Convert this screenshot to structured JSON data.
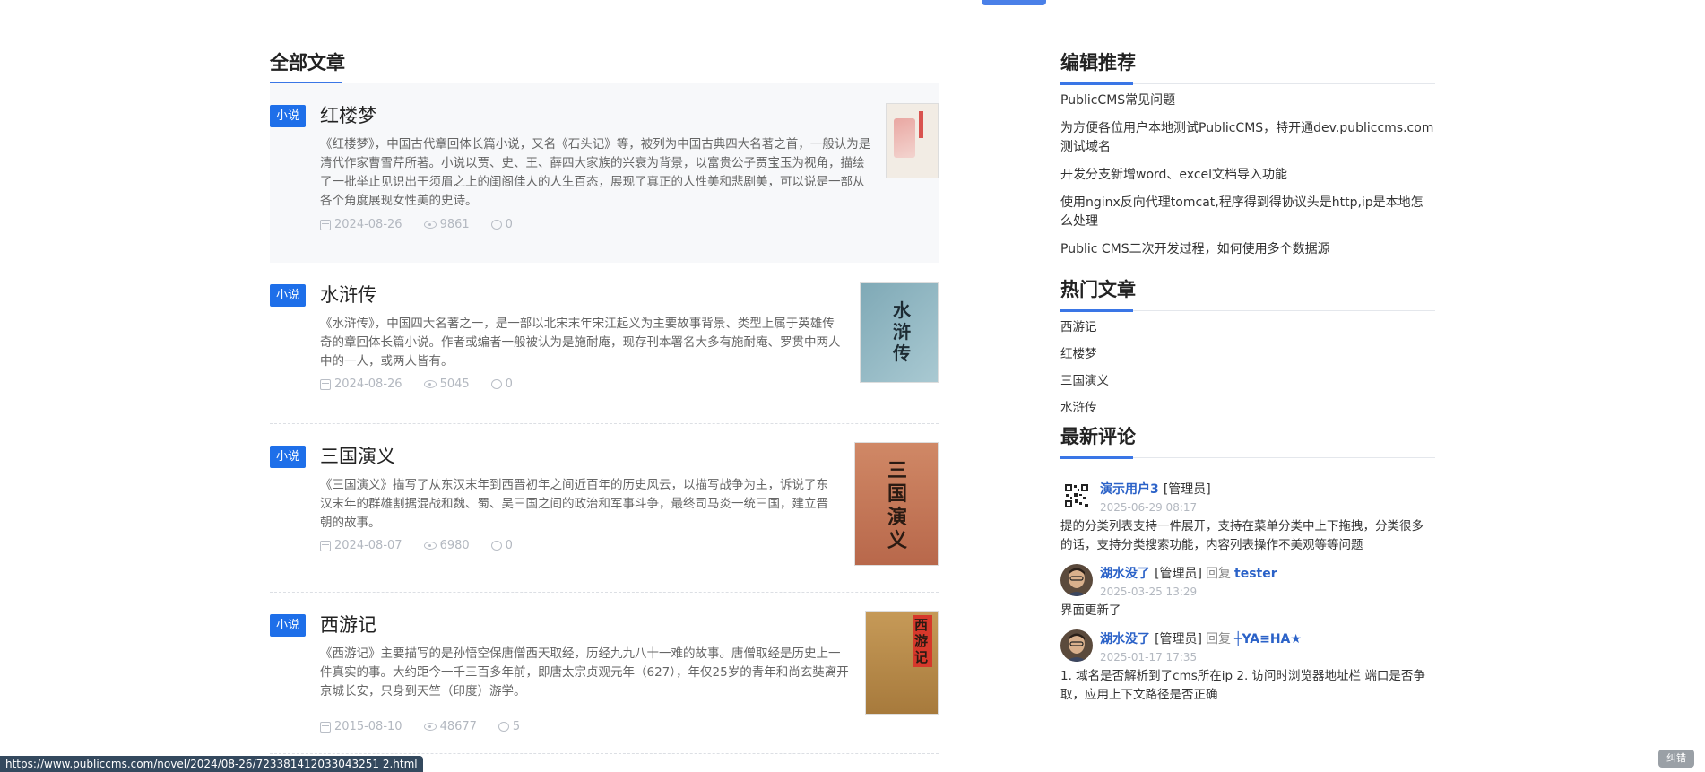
{
  "main": {
    "section_title": "全部文章",
    "articles": [
      {
        "category": "小说",
        "title": "红楼梦",
        "description": "《红楼梦》，中国古代章回体长篇小说，又名《石头记》等，被列为中国古典四大名著之首，一般认为是清代作家曹雪芹所著。小说以贾、史、王、薛四大家族的兴衰为背景，以富贵公子贾宝玉为视角，描绘了一批举止见识出于须眉之上的闺阁佳人的人生百态，展现了真正的人性美和悲剧美，可以说是一部从各个角度展现女性美的史诗。",
        "date": "2024-08-26",
        "views": "9861",
        "comments": "0",
        "cover_color": "#f2ece4"
      },
      {
        "category": "小说",
        "title": "水浒传",
        "description": "《水浒传》，中国四大名著之一，是一部以北宋末年宋江起义为主要故事背景、类型上属于英雄传奇的章回体长篇小说。作者或编者一般被认为是施耐庵，现存刊本署名大多有施耐庵、罗贯中两人中的一人，或两人皆有。",
        "date": "2024-08-26",
        "views": "5045",
        "comments": "0",
        "cover_color": "#8fb7c3"
      },
      {
        "category": "小说",
        "title": "三国演义",
        "description": "《三国演义》描写了从东汉末年到西晋初年之间近百年的历史风云，以描写战争为主，诉说了东汉末年的群雄割据混战和魏、蜀、吴三国之间的政治和军事斗争，最终司马炎一统三国，建立晋朝的故事。",
        "date": "2024-08-07",
        "views": "6980",
        "comments": "0",
        "cover_color": "#c9775a"
      },
      {
        "category": "小说",
        "title": "西游记",
        "description": "《西游记》主要描写的是孙悟空保唐僧西天取经，历经九九八十一难的故事。唐僧取经是历史上一件真实的事。大约距今一千三百多年前，即唐太宗贞观元年（627），年仅25岁的青年和尚玄奘离开京城长安，只身到天竺（印度）游学。",
        "date": "2015-08-10",
        "views": "48677",
        "comments": "5",
        "cover_color": "#b88a4a"
      }
    ]
  },
  "sidebar": {
    "editor_title": "编辑推荐",
    "editor_items": [
      "PublicCMS常见问题",
      "为方便各位用户本地测试PublicCMS，特开通dev.publiccms.com测试域名",
      "开发分支新增word、excel文档导入功能",
      "使用nginx反向代理tomcat,程序得到得协议头是http,ip是本地怎么处理",
      "Public CMS二次开发过程，如何使用多个数据源"
    ],
    "hot_title": "热门文章",
    "hot_items": [
      "西游记",
      "红楼梦",
      "三国演义",
      "水浒传"
    ],
    "comments_title": "最新评论",
    "comments": [
      {
        "name": "演示用户3",
        "role": "[管理员]",
        "reply_label": "",
        "reply_to": "",
        "time": "2025-06-29 08:17",
        "body": "提的分类列表支持一件展开，支持在菜单分类中上下拖拽，分类很多的话，支持分类搜索功能，内容列表操作不美观等等问题"
      },
      {
        "name": "湖水没了",
        "role": "[管理员]",
        "reply_label": "回复",
        "reply_to": "tester",
        "time": "2025-03-25 13:29",
        "body": "界面更新了"
      },
      {
        "name": "湖水没了",
        "role": "[管理员]",
        "reply_label": "回复",
        "reply_to": "┼YA≡HA★",
        "time": "2025-01-17 17:35",
        "body": "1. 域名是否解析到了cms所在ip 2. 访问时浏览器地址栏 端口是否争取，应用上下文路径是否正确"
      }
    ]
  },
  "status_url": "https://www.publiccms.com/novel/2024/08-26/723381412033043251 2.html",
  "corner_button": "纠错"
}
